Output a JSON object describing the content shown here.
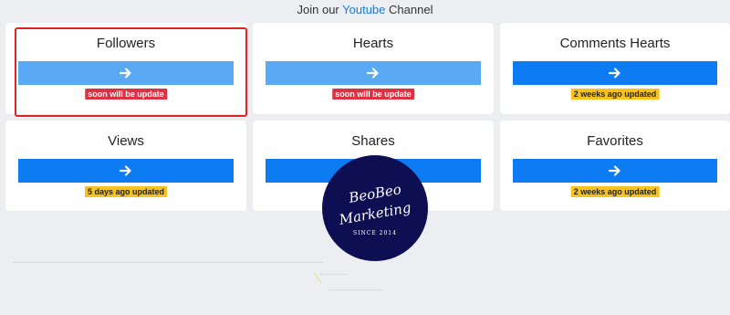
{
  "header": {
    "prefix": "Join our",
    "link": "Youtube",
    "suffix": "Channel"
  },
  "cards": [
    {
      "title": "Followers",
      "badge": "soon will be update"
    },
    {
      "title": "Hearts",
      "badge": "soon will be update"
    },
    {
      "title": "Comments Hearts",
      "badge": "2 weeks ago updated"
    },
    {
      "title": "Views",
      "badge": "5 days ago updated"
    },
    {
      "title": "Shares",
      "badge": ""
    },
    {
      "title": "Favorites",
      "badge": "2 weeks ago updated"
    }
  ],
  "logo": {
    "line1": "BeoBeo",
    "line2": "Marketing",
    "line3": "SINCE 2014"
  },
  "icons": {
    "bar_icon": "arrow-right-icon"
  },
  "colors": {
    "bar_light": "#5aa9f5",
    "bar_strong": "#0d7bf2",
    "badge_red": "#db3344",
    "badge_yellow": "#f7c21b",
    "highlight": "#e02424",
    "logo_bg": "#0e0e52"
  }
}
